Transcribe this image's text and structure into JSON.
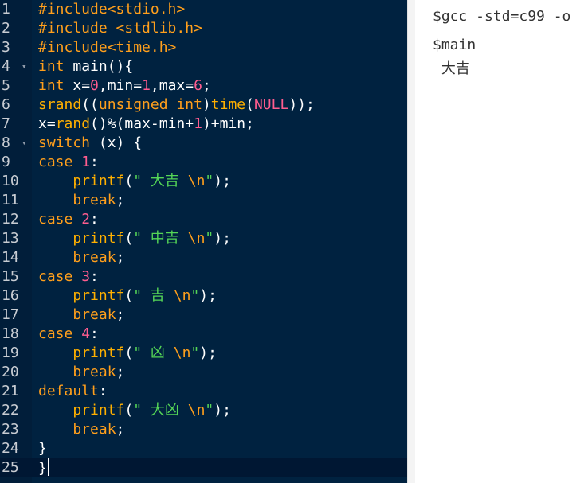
{
  "editor": {
    "colors": {
      "background": "#002240",
      "preprocessor": "#ff9f1c",
      "keyword": "#ff9f1c",
      "number": "#ff5d8f",
      "function": "#ffb000",
      "string": "#55d656",
      "text": "#ffffff"
    },
    "cursor_line": 25,
    "lines": [
      {
        "num": "1",
        "fold": false,
        "tokens": [
          {
            "t": "#include<stdio.h>",
            "c": "preproc"
          }
        ]
      },
      {
        "num": "2",
        "fold": false,
        "tokens": [
          {
            "t": "#include <stdlib.h>",
            "c": "preproc"
          }
        ]
      },
      {
        "num": "3",
        "fold": false,
        "tokens": [
          {
            "t": "#include<time.h>",
            "c": "preproc"
          }
        ]
      },
      {
        "num": "4",
        "fold": true,
        "tokens": [
          {
            "t": "int",
            "c": "keyword"
          },
          {
            "t": " main(){",
            "c": "default"
          }
        ]
      },
      {
        "num": "5",
        "fold": false,
        "tokens": [
          {
            "t": "int",
            "c": "keyword"
          },
          {
            "t": " x=",
            "c": "default"
          },
          {
            "t": "0",
            "c": "number"
          },
          {
            "t": ",min=",
            "c": "default"
          },
          {
            "t": "1",
            "c": "number"
          },
          {
            "t": ",max=",
            "c": "default"
          },
          {
            "t": "6",
            "c": "number"
          },
          {
            "t": ";",
            "c": "default"
          }
        ]
      },
      {
        "num": "6",
        "fold": false,
        "tokens": [
          {
            "t": "srand",
            "c": "func"
          },
          {
            "t": "((",
            "c": "default"
          },
          {
            "t": "unsigned int",
            "c": "keyword"
          },
          {
            "t": ")",
            "c": "default"
          },
          {
            "t": "time",
            "c": "func"
          },
          {
            "t": "(",
            "c": "default"
          },
          {
            "t": "NULL",
            "c": "number"
          },
          {
            "t": "));",
            "c": "default"
          }
        ]
      },
      {
        "num": "7",
        "fold": false,
        "tokens": [
          {
            "t": "x=",
            "c": "default"
          },
          {
            "t": "rand",
            "c": "func"
          },
          {
            "t": "()%(max-min+",
            "c": "default"
          },
          {
            "t": "1",
            "c": "number"
          },
          {
            "t": ")+min;",
            "c": "default"
          }
        ]
      },
      {
        "num": "8",
        "fold": true,
        "tokens": [
          {
            "t": "switch",
            "c": "keyword"
          },
          {
            "t": " (x) {",
            "c": "default"
          }
        ]
      },
      {
        "num": "9",
        "fold": false,
        "tokens": [
          {
            "t": "case",
            "c": "keyword"
          },
          {
            "t": " ",
            "c": "default"
          },
          {
            "t": "1",
            "c": "number"
          },
          {
            "t": ":",
            "c": "default"
          }
        ]
      },
      {
        "num": "10",
        "fold": false,
        "tokens": [
          {
            "t": "    printf",
            "c": "func"
          },
          {
            "t": "(",
            "c": "default"
          },
          {
            "t": "\" 大吉 ",
            "c": "string"
          },
          {
            "t": "\\n",
            "c": "escape"
          },
          {
            "t": "\"",
            "c": "string"
          },
          {
            "t": ");",
            "c": "default"
          }
        ]
      },
      {
        "num": "11",
        "fold": false,
        "tokens": [
          {
            "t": "    break",
            "c": "keyword"
          },
          {
            "t": ";",
            "c": "default"
          }
        ]
      },
      {
        "num": "12",
        "fold": false,
        "tokens": [
          {
            "t": "case",
            "c": "keyword"
          },
          {
            "t": " ",
            "c": "default"
          },
          {
            "t": "2",
            "c": "number"
          },
          {
            "t": ":",
            "c": "default"
          }
        ]
      },
      {
        "num": "13",
        "fold": false,
        "tokens": [
          {
            "t": "    printf",
            "c": "func"
          },
          {
            "t": "(",
            "c": "default"
          },
          {
            "t": "\" 中吉 ",
            "c": "string"
          },
          {
            "t": "\\n",
            "c": "escape"
          },
          {
            "t": "\"",
            "c": "string"
          },
          {
            "t": ");",
            "c": "default"
          }
        ]
      },
      {
        "num": "14",
        "fold": false,
        "tokens": [
          {
            "t": "    break",
            "c": "keyword"
          },
          {
            "t": ";",
            "c": "default"
          }
        ]
      },
      {
        "num": "15",
        "fold": false,
        "tokens": [
          {
            "t": "case",
            "c": "keyword"
          },
          {
            "t": " ",
            "c": "default"
          },
          {
            "t": "3",
            "c": "number"
          },
          {
            "t": ":",
            "c": "default"
          }
        ]
      },
      {
        "num": "16",
        "fold": false,
        "tokens": [
          {
            "t": "    printf",
            "c": "func"
          },
          {
            "t": "(",
            "c": "default"
          },
          {
            "t": "\" 吉 ",
            "c": "string"
          },
          {
            "t": "\\n",
            "c": "escape"
          },
          {
            "t": "\"",
            "c": "string"
          },
          {
            "t": ");",
            "c": "default"
          }
        ]
      },
      {
        "num": "17",
        "fold": false,
        "tokens": [
          {
            "t": "    break",
            "c": "keyword"
          },
          {
            "t": ";",
            "c": "default"
          }
        ]
      },
      {
        "num": "18",
        "fold": false,
        "tokens": [
          {
            "t": "case",
            "c": "keyword"
          },
          {
            "t": " ",
            "c": "default"
          },
          {
            "t": "4",
            "c": "number"
          },
          {
            "t": ":",
            "c": "default"
          }
        ]
      },
      {
        "num": "19",
        "fold": false,
        "tokens": [
          {
            "t": "    printf",
            "c": "func"
          },
          {
            "t": "(",
            "c": "default"
          },
          {
            "t": "\" 凶 ",
            "c": "string"
          },
          {
            "t": "\\n",
            "c": "escape"
          },
          {
            "t": "\"",
            "c": "string"
          },
          {
            "t": ");",
            "c": "default"
          }
        ]
      },
      {
        "num": "20",
        "fold": false,
        "tokens": [
          {
            "t": "    break",
            "c": "keyword"
          },
          {
            "t": ";",
            "c": "default"
          }
        ]
      },
      {
        "num": "21",
        "fold": false,
        "tokens": [
          {
            "t": "default",
            "c": "keyword"
          },
          {
            "t": ":",
            "c": "default"
          }
        ]
      },
      {
        "num": "22",
        "fold": false,
        "tokens": [
          {
            "t": "    printf",
            "c": "func"
          },
          {
            "t": "(",
            "c": "default"
          },
          {
            "t": "\" 大凶 ",
            "c": "string"
          },
          {
            "t": "\\n",
            "c": "escape"
          },
          {
            "t": "\"",
            "c": "string"
          },
          {
            "t": ");",
            "c": "default"
          }
        ]
      },
      {
        "num": "23",
        "fold": false,
        "tokens": [
          {
            "t": "    break",
            "c": "keyword"
          },
          {
            "t": ";",
            "c": "default"
          }
        ]
      },
      {
        "num": "24",
        "fold": false,
        "tokens": [
          {
            "t": "}",
            "c": "default"
          }
        ]
      },
      {
        "num": "25",
        "fold": false,
        "tokens": [
          {
            "t": "}",
            "c": "default"
          }
        ]
      }
    ]
  },
  "output": {
    "lines": [
      "$gcc -std=c99 -o",
      "$main",
      " 大吉"
    ]
  }
}
